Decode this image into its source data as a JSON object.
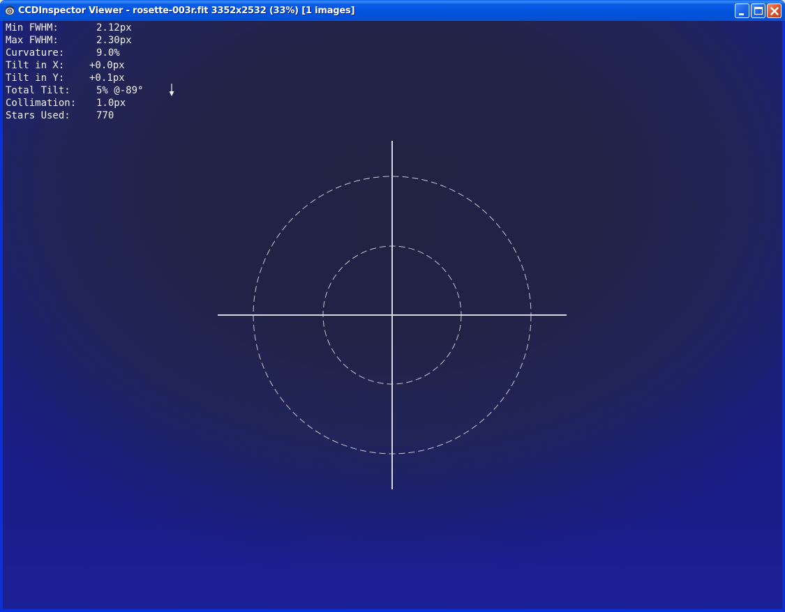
{
  "window": {
    "title": "CCDInspector Viewer - rosette-003r.fit 3352x2532 (33%)  [1 images]",
    "icon": "ccdinspector-app-icon"
  },
  "controls": {
    "minimize_icon": "minimize-icon",
    "maximize_icon": "maximize-icon",
    "close_icon": "close-icon"
  },
  "stats": [
    {
      "label": "Min FWHM:",
      "value": "2.12px"
    },
    {
      "label": "Max FWHM:",
      "value": "2.30px"
    },
    {
      "label": "Curvature:",
      "value": "9.0%"
    },
    {
      "label": "Tilt in X:",
      "value": "+0.0px"
    },
    {
      "label": "Tilt in Y:",
      "value": "+0.1px"
    },
    {
      "label": "Total Tilt:",
      "value": "5% @-89°"
    },
    {
      "label": "Collimation:",
      "value": "1.0px"
    },
    {
      "label": "Stars Used:",
      "value": "770"
    }
  ],
  "collimation_plot": {
    "tilt_direction_indicator": "down-arrow-icon",
    "crosshair": true,
    "reference_rings": 2
  },
  "colors": {
    "titlebar": "#0453dd",
    "background_top": "#222244",
    "background_bottom": "#1e22a0",
    "overlay": "#dcdce8"
  }
}
